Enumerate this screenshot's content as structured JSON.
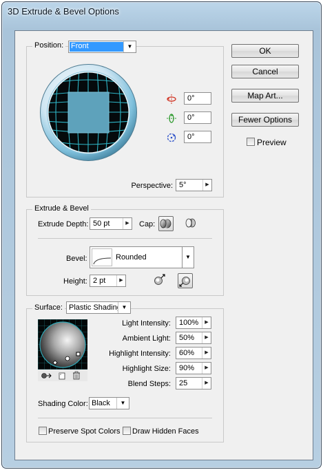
{
  "window": {
    "title": "3D Extrude & Bevel Options"
  },
  "position": {
    "label": "Position:",
    "preset": "Front",
    "rotations": [
      {
        "axis_icon": "rotate-x-axis-icon",
        "value": "0°",
        "color": "#d23a2a"
      },
      {
        "axis_icon": "rotate-y-axis-icon",
        "value": "0°",
        "color": "#2e9a2e"
      },
      {
        "axis_icon": "rotate-z-axis-icon",
        "value": "0°",
        "color": "#2a4fc8"
      }
    ],
    "perspective_label": "Perspective:",
    "perspective_value": "5°"
  },
  "extrude": {
    "title": "Extrude & Bevel",
    "depth_label": "Extrude Depth:",
    "depth_value": "50 pt",
    "cap_label": "Cap:",
    "bevel_label": "Bevel:",
    "bevel_value": "Rounded",
    "height_label": "Height:",
    "height_value": "2 pt"
  },
  "surface": {
    "label": "Surface:",
    "value": "Plastic Shading",
    "light_intensity_label": "Light Intensity:",
    "light_intensity": "100%",
    "ambient_light_label": "Ambient Light:",
    "ambient_light": "50%",
    "highlight_intensity_label": "Highlight Intensity:",
    "highlight_intensity": "60%",
    "highlight_size_label": "Highlight Size:",
    "highlight_size": "90%",
    "blend_steps_label": "Blend Steps:",
    "blend_steps": "25",
    "shading_color_label": "Shading Color:",
    "shading_color": "Black",
    "preserve_spot_label": "Preserve Spot Colors",
    "draw_hidden_label": "Draw Hidden Faces"
  },
  "buttons": {
    "ok": "OK",
    "cancel": "Cancel",
    "map_art": "Map Art...",
    "fewer_options": "Fewer Options"
  },
  "preview": {
    "label": "Preview",
    "checked": false
  },
  "colors": {
    "preset_highlight": "#3399ff",
    "trackball_face": "#5ea2bb",
    "grid_line": "#2fb7c8",
    "dialog_bg": "#f0f0f0"
  }
}
